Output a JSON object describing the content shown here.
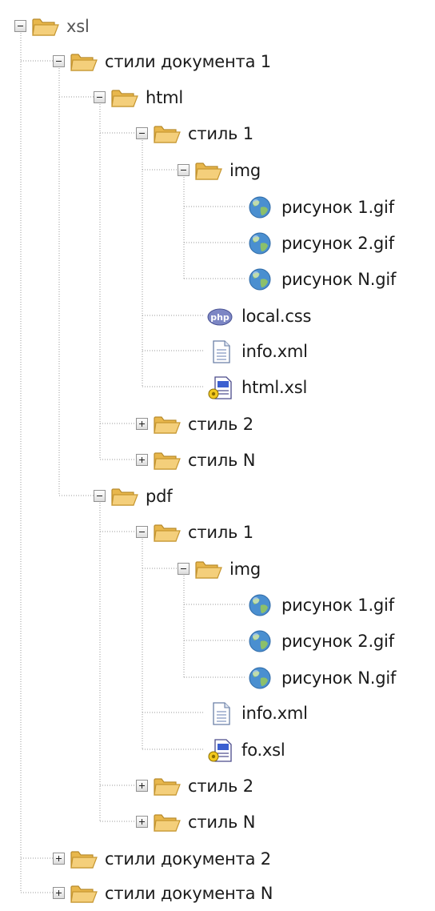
{
  "window": {
    "title": ""
  },
  "colors": {
    "text": "#1a1a1a",
    "folder": "#f4cf7b",
    "connector": "#9a9a9a",
    "web_icon": "#4a8fd0"
  },
  "tree": [
    {
      "label": "xsl",
      "icon": "folder-open-icon",
      "expander": "minus"
    },
    {
      "label": "стили документа 1",
      "icon": "folder-open-icon",
      "expander": "minus"
    },
    {
      "label": "html",
      "icon": "folder-open-icon",
      "expander": "minus"
    },
    {
      "label": "стиль 1",
      "icon": "folder-open-icon",
      "expander": "minus"
    },
    {
      "label": "img",
      "icon": "folder-open-icon",
      "expander": "minus"
    },
    {
      "label": "рисунок 1.gif",
      "icon": "globe-image-icon",
      "expander": "none"
    },
    {
      "label": "рисунок 2.gif",
      "icon": "globe-image-icon",
      "expander": "none"
    },
    {
      "label": "рисунок N.gif",
      "icon": "globe-image-icon",
      "expander": "none"
    },
    {
      "label": "local.css",
      "icon": "css-file-icon",
      "expander": "none"
    },
    {
      "label": "info.xml",
      "icon": "text-file-icon",
      "expander": "none"
    },
    {
      "label": "html.xsl",
      "icon": "xsl-file-icon",
      "expander": "none"
    },
    {
      "label": "стиль 2",
      "icon": "folder-open-icon",
      "expander": "plus"
    },
    {
      "label": "стиль N",
      "icon": "folder-open-icon",
      "expander": "plus"
    },
    {
      "label": "pdf",
      "icon": "folder-open-icon",
      "expander": "minus"
    },
    {
      "label": "стиль 1",
      "icon": "folder-open-icon",
      "expander": "minus"
    },
    {
      "label": "img",
      "icon": "folder-open-icon",
      "expander": "minus"
    },
    {
      "label": "рисунок 1.gif",
      "icon": "globe-image-icon",
      "expander": "none"
    },
    {
      "label": "рисунок 2.gif",
      "icon": "globe-image-icon",
      "expander": "none"
    },
    {
      "label": "рисунок N.gif",
      "icon": "globe-image-icon",
      "expander": "none"
    },
    {
      "label": "info.xml",
      "icon": "text-file-icon",
      "expander": "none"
    },
    {
      "label": "fo.xsl",
      "icon": "xsl-file-icon",
      "expander": "none"
    },
    {
      "label": "стиль 2",
      "icon": "folder-open-icon",
      "expander": "plus"
    },
    {
      "label": "стиль N",
      "icon": "folder-open-icon",
      "expander": "plus"
    },
    {
      "label": "стили документа 2",
      "icon": "folder-open-icon",
      "expander": "plus"
    },
    {
      "label": "стили документа N",
      "icon": "folder-open-icon",
      "expander": "plus"
    }
  ]
}
